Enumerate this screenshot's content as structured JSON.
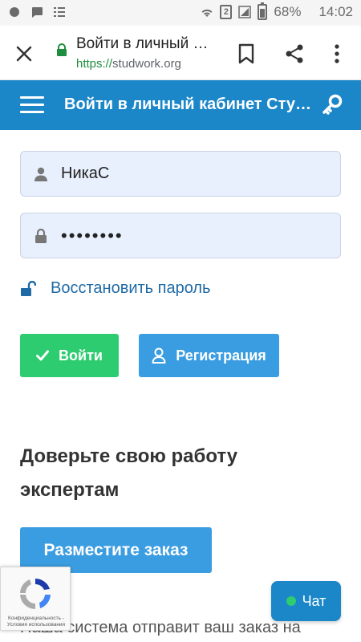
{
  "status_bar": {
    "battery": "68%",
    "time": "14:02",
    "sim_slot": "2",
    "battery_level": 0.68
  },
  "browser": {
    "page_title": "Войти в личный …",
    "url_scheme": "https://",
    "url_host": "studwork.org"
  },
  "header": {
    "title": "Войти в личный кабинет Сту…"
  },
  "form": {
    "login_value": "НикаС",
    "password_value": "••••••••",
    "restore_label": "Восстановить пароль",
    "login_button": "Войти",
    "register_button": "Регистрация"
  },
  "promo": {
    "heading": "Доверьте свою работу экспертам",
    "order_button": "Разместите заказ",
    "footer_text": "Наша система отправит ваш заказ на"
  },
  "recaptcha": {
    "terms": "Конфиденциальность - Условия использования"
  },
  "chat": {
    "label": "Чат"
  },
  "colors": {
    "header_bg": "#1b87c9",
    "login_green": "#2ecc71",
    "register_blue": "#3b9de1",
    "link_blue": "#1f6aa5",
    "field_bg": "#e8f0fe"
  }
}
